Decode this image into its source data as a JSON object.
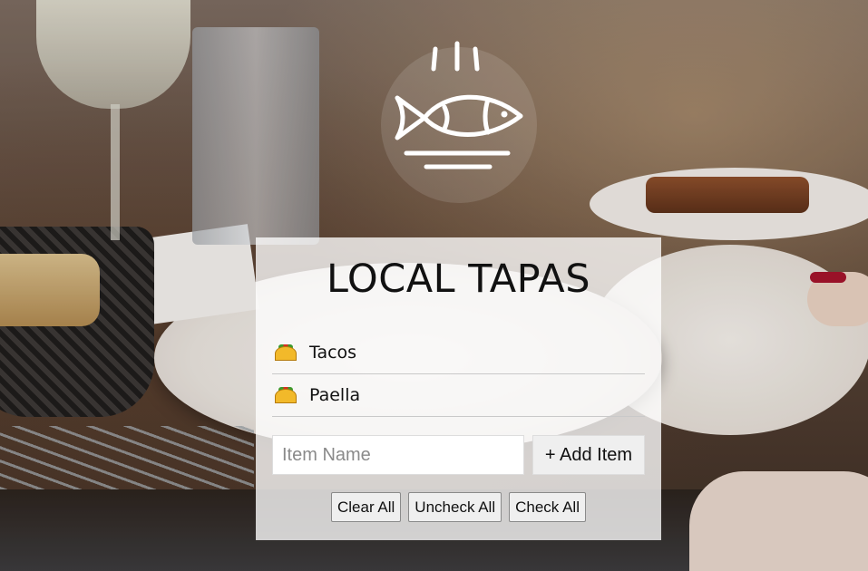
{
  "app": {
    "title": "LOCAL TAPAS",
    "logo_icon": "fish-plate-icon"
  },
  "list": {
    "items": [
      {
        "label": "Tacos",
        "icon": "taco-icon"
      },
      {
        "label": "Paella",
        "icon": "taco-icon"
      }
    ]
  },
  "form": {
    "input_value": "",
    "input_placeholder": "Item Name",
    "add_label": "+ Add Item"
  },
  "actions": {
    "clear_label": "Clear All",
    "uncheck_label": "Uncheck All",
    "check_label": "Check All"
  },
  "colors": {
    "card_background": "#ffffffc7",
    "text": "#111111"
  }
}
